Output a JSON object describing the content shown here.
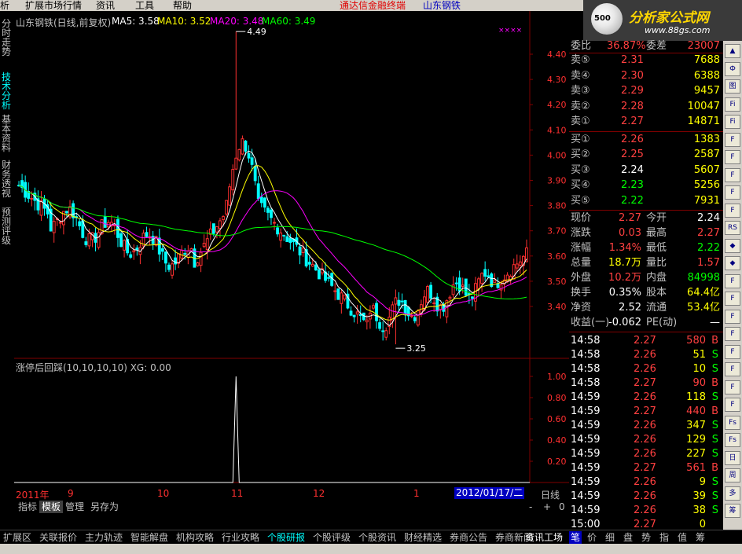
{
  "menu": {
    "items": [
      "析",
      "扩展市场行情",
      "资讯",
      "工具",
      "帮助"
    ],
    "app_title": "通达信金融终端",
    "stock_title": "山东钢铁"
  },
  "brand": {
    "logo_text": "分析家公式网",
    "logo_url": "www.88gs.com",
    "logo_num": "500"
  },
  "left_tabs": [
    {
      "label": "分时走势",
      "active": false
    },
    {
      "label": "技术分析",
      "active": true
    },
    {
      "label": "基本资料",
      "active": false
    },
    {
      "label": "财务透视",
      "active": false
    },
    {
      "label": "预测评级",
      "active": false
    }
  ],
  "chart_header": {
    "stock": "山东钢铁(日线,前复权)",
    "ma5": "MA5: 3.58",
    "ma10": "MA10: 3.52",
    "ma20": "MA20: 3.48",
    "ma60": "MA60: 3.49",
    "marker": "××××"
  },
  "indicator_header": "涨停后回踩(10,10,10,10) XG: 0.00",
  "price_axis": [
    "4.40",
    "4.30",
    "4.20",
    "4.10",
    "4.00",
    "3.90",
    "3.80",
    "3.70",
    "3.60",
    "3.50",
    "3.40"
  ],
  "ind_axis": [
    "1.00",
    "0.80",
    "0.60",
    "0.40",
    "0.20"
  ],
  "annotations": {
    "high": "4.49",
    "low": "3.25"
  },
  "date_axis": [
    "2011年",
    "9",
    "10",
    "11",
    "12",
    "1"
  ],
  "current_date": "2012/01/17/二",
  "period": "日线",
  "sub_tabs": [
    {
      "label": "指标",
      "sel": false
    },
    {
      "label": "模板",
      "sel": true
    },
    {
      "label": "管理",
      "sel": false
    },
    {
      "label": "另存为",
      "sel": false
    }
  ],
  "sub_controls": [
    "-",
    "+",
    "0"
  ],
  "order_book": {
    "header": {
      "label1": "委比",
      "val1": "36.87%",
      "label2": "委差",
      "val2": "23007"
    },
    "sells": [
      {
        "label": "卖⑤",
        "price": "2.31",
        "vol": "7688"
      },
      {
        "label": "卖④",
        "price": "2.30",
        "vol": "6388"
      },
      {
        "label": "卖③",
        "price": "2.29",
        "vol": "9457"
      },
      {
        "label": "卖②",
        "price": "2.28",
        "vol": "10047"
      },
      {
        "label": "卖①",
        "price": "2.27",
        "vol": "14871"
      }
    ],
    "buys": [
      {
        "label": "买①",
        "price": "2.26",
        "vol": "1383",
        "color": "#ff4040"
      },
      {
        "label": "买②",
        "price": "2.25",
        "vol": "2587",
        "color": "#ff4040"
      },
      {
        "label": "买③",
        "price": "2.24",
        "vol": "5607",
        "color": "#ffffff"
      },
      {
        "label": "买④",
        "price": "2.23",
        "vol": "5256",
        "color": "#00ff00"
      },
      {
        "label": "买⑤",
        "price": "2.22",
        "vol": "7931",
        "color": "#00ff00"
      }
    ]
  },
  "quote": [
    {
      "l1": "现价",
      "v1": "2.27",
      "c1": "#ff4040",
      "l2": "今开",
      "v2": "2.24",
      "c2": "#ffffff"
    },
    {
      "l1": "涨跌",
      "v1": "0.03",
      "c1": "#ff4040",
      "l2": "最高",
      "v2": "2.27",
      "c2": "#ff4040"
    },
    {
      "l1": "涨幅",
      "v1": "1.34%",
      "c1": "#ff4040",
      "l2": "最低",
      "v2": "2.22",
      "c2": "#00ff00"
    },
    {
      "l1": "总量",
      "v1": "18.7万",
      "c1": "#ffff00",
      "l2": "量比",
      "v2": "1.57",
      "c2": "#ff4040"
    },
    {
      "l1": "外盘",
      "v1": "10.2万",
      "c1": "#ff4040",
      "l2": "内盘",
      "v2": "84998",
      "c2": "#00ff00"
    },
    {
      "l1": "换手",
      "v1": "0.35%",
      "c1": "#ffffff",
      "l2": "股本",
      "v2": "64.4亿",
      "c2": "#ffff00"
    },
    {
      "l1": "净资",
      "v1": "2.52",
      "c1": "#ffffff",
      "l2": "流通",
      "v2": "53.4亿",
      "c2": "#ffff00"
    },
    {
      "l1": "收益(一)",
      "v1": "-0.062",
      "c1": "#ffffff",
      "l2": "PE(动)",
      "v2": "—",
      "c2": "#ffffff"
    }
  ],
  "ticks": [
    {
      "t": "14:58",
      "p": "2.27",
      "v": "580",
      "d": "B"
    },
    {
      "t": "14:58",
      "p": "2.26",
      "v": "51",
      "d": "S"
    },
    {
      "t": "14:58",
      "p": "2.26",
      "v": "10",
      "d": "S"
    },
    {
      "t": "14:58",
      "p": "2.27",
      "v": "90",
      "d": "B"
    },
    {
      "t": "14:59",
      "p": "2.26",
      "v": "118",
      "d": "S"
    },
    {
      "t": "14:59",
      "p": "2.27",
      "v": "440",
      "d": "B"
    },
    {
      "t": "14:59",
      "p": "2.26",
      "v": "347",
      "d": "S"
    },
    {
      "t": "14:59",
      "p": "2.26",
      "v": "129",
      "d": "S"
    },
    {
      "t": "14:59",
      "p": "2.26",
      "v": "227",
      "d": "S"
    },
    {
      "t": "14:59",
      "p": "2.27",
      "v": "561",
      "d": "B"
    },
    {
      "t": "14:59",
      "p": "2.26",
      "v": "9",
      "d": "S"
    },
    {
      "t": "14:59",
      "p": "2.26",
      "v": "39",
      "d": "S"
    },
    {
      "t": "14:59",
      "p": "2.26",
      "v": "38",
      "d": "S"
    },
    {
      "t": "15:00",
      "p": "2.27",
      "v": "0",
      "d": ""
    }
  ],
  "side_tools": [
    "▲",
    "Ф",
    "图",
    "Fi",
    "Fi",
    "F",
    "F",
    "F",
    "F",
    "F",
    "RS",
    "◆",
    "◆",
    "F",
    "F",
    "F",
    "F",
    "F",
    "F",
    "F",
    "F",
    "Fs",
    "Fs",
    "日",
    "周",
    "多",
    "筹"
  ],
  "func_bar": [
    {
      "label": "扩展区",
      "c": "#c0c0c0"
    },
    {
      "label": "关联报价",
      "c": "#c0c0c0"
    },
    {
      "label": "主力轨迹",
      "c": "#c0c0c0"
    },
    {
      "label": "智能解盘",
      "c": "#c0c0c0"
    },
    {
      "label": "机构攻略",
      "c": "#c0c0c0"
    },
    {
      "label": "行业攻略",
      "c": "#c0c0c0"
    },
    {
      "label": "个股研报",
      "c": "#00ffff"
    },
    {
      "label": "个股评级",
      "c": "#c0c0c0"
    },
    {
      "label": "个股资讯",
      "c": "#c0c0c0"
    },
    {
      "label": "财经精选",
      "c": "#c0c0c0"
    },
    {
      "label": "券商公告",
      "c": "#c0c0c0"
    },
    {
      "label": "券商新闻",
      "c": "#c0c0c0"
    }
  ],
  "func_right": [
    {
      "label": "资讯工场",
      "c": "#ffffff"
    },
    {
      "label": "笔",
      "c": "#ffffff"
    },
    {
      "label": "价",
      "c": "#c0c0c0"
    },
    {
      "label": "细",
      "c": "#c0c0c0"
    },
    {
      "label": "盘",
      "c": "#c0c0c0"
    },
    {
      "label": "势",
      "c": "#c0c0c0"
    },
    {
      "label": "指",
      "c": "#c0c0c0"
    },
    {
      "label": "值",
      "c": "#c0c0c0"
    },
    {
      "label": "筹",
      "c": "#c0c0c0"
    }
  ],
  "colors": {
    "up": "#ff3030",
    "down": "#00ffff",
    "ma5": "#ffffff",
    "ma10": "#ffff00",
    "ma20": "#ff00ff",
    "ma60": "#00ff00"
  }
}
